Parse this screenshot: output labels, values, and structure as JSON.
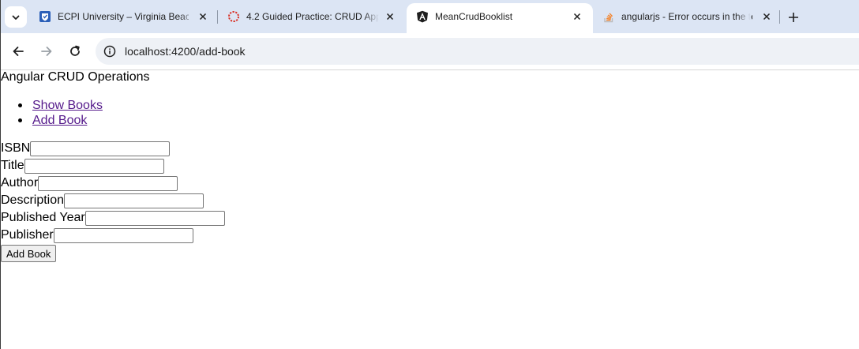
{
  "tabs": [
    {
      "title": "ECPI University – Virginia Beach",
      "favicon": "shield-icon",
      "active": false
    },
    {
      "title": "4.2 Guided Practice: CRUD Appl",
      "favicon": "ring-icon",
      "active": false
    },
    {
      "title": "MeanCrudBooklist",
      "favicon": "angular-icon",
      "active": true
    },
    {
      "title": "angularjs - Error occurs in the te",
      "favicon": "stackoverflow-icon",
      "active": false
    }
  ],
  "address_bar": {
    "url": "localhost:4200/add-book"
  },
  "page": {
    "app_title": "Angular CRUD Operations",
    "nav_links": [
      "Show Books",
      "Add Book"
    ],
    "form": {
      "fields": [
        {
          "label": "ISBN",
          "value": ""
        },
        {
          "label": "Title",
          "value": ""
        },
        {
          "label": "Author",
          "value": ""
        },
        {
          "label": "Description",
          "value": ""
        },
        {
          "label": "Published Year",
          "value": ""
        },
        {
          "label": "Publisher",
          "value": ""
        }
      ],
      "submit_label": "Add Book"
    }
  },
  "colors": {
    "tabstrip_bg": "#dce5f4",
    "omnibox_bg": "#eef1f6",
    "visited_link": "#551a8b"
  }
}
